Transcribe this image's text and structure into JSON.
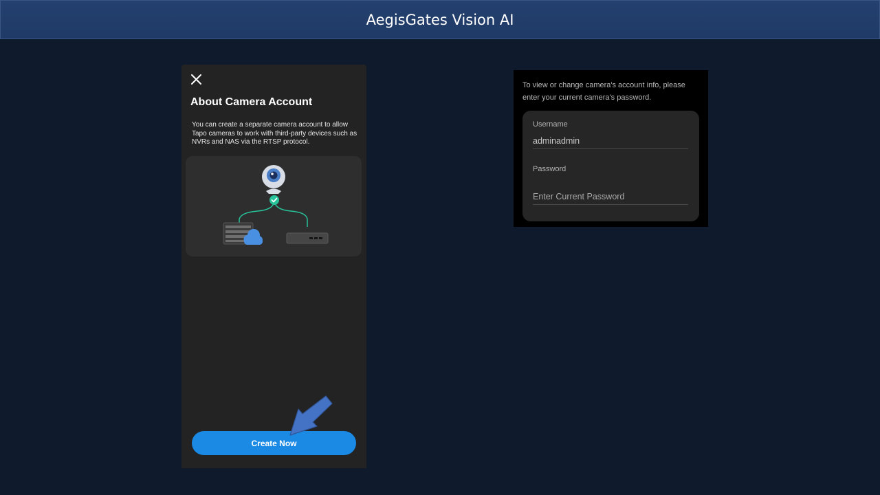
{
  "header": {
    "title": "AegisGates Vision AI"
  },
  "left_screen": {
    "close_icon": "close-icon",
    "title": "About Camera Account",
    "description": "You can create a separate camera account to allow Tapo cameras to work with third-party devices such as NVRs and NAS via the RTSP protocol.",
    "illustration_icons": [
      "camera-icon",
      "check-icon",
      "nvr-icon",
      "cloud-icon",
      "nas-icon"
    ],
    "create_button": "Create Now",
    "annotation": "arrow-pointer-icon"
  },
  "right_screen": {
    "description": "To view or change camera's account info, please enter your current camera's password.",
    "username_label": "Username",
    "username_value": "adminadmin",
    "password_label": "Password",
    "password_placeholder": "Enter Current Password"
  },
  "colors": {
    "header_bg": "#1f3a66",
    "page_bg": "#0f1a2c",
    "accent_button": "#1a8ae5",
    "check_green": "#27c39a",
    "arrow_blue": "#4472c4"
  }
}
